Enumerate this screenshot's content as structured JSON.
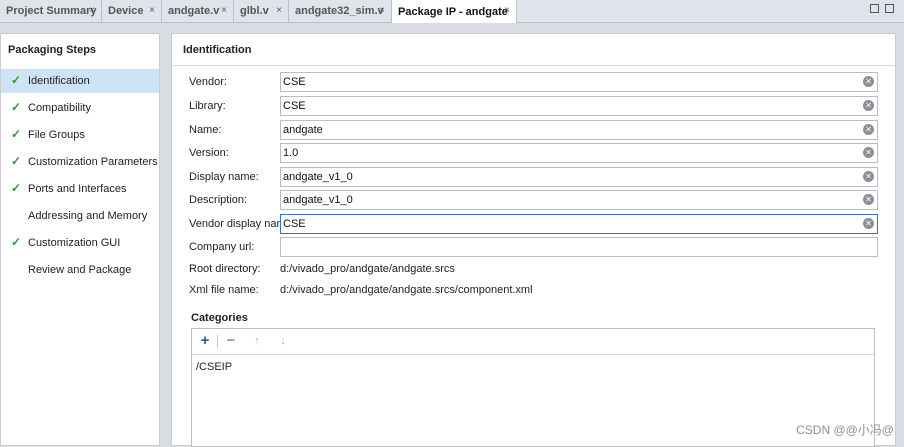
{
  "tabs": [
    {
      "label": "Project Summary",
      "close": "×"
    },
    {
      "label": "Device",
      "close": "×"
    },
    {
      "label": "andgate.v",
      "close": "×"
    },
    {
      "label": "glbl.v",
      "close": "×"
    },
    {
      "label": "andgate32_sim.v",
      "close": "×"
    },
    {
      "label": "Package IP - andgate",
      "close": "×"
    }
  ],
  "left_panel": {
    "title": "Packaging Steps",
    "check": "✓",
    "steps": [
      {
        "label": "Identification"
      },
      {
        "label": "Compatibility"
      },
      {
        "label": "File Groups"
      },
      {
        "label": "Customization Parameters"
      },
      {
        "label": "Ports and Interfaces"
      },
      {
        "label": "Addressing and Memory"
      },
      {
        "label": "Customization GUI"
      },
      {
        "label": "Review and Package"
      }
    ]
  },
  "identification": {
    "title": "Identification",
    "fields": [
      {
        "label": "Vendor:",
        "value": "CSE"
      },
      {
        "label": "Library:",
        "value": "CSE"
      },
      {
        "label": "Name:",
        "value": "andgate"
      },
      {
        "label": "Version:",
        "value": "1.0"
      },
      {
        "label": "Display name:",
        "value": "andgate_v1_0"
      },
      {
        "label": "Description:",
        "value": "andgate_v1_0"
      },
      {
        "label": "Vendor display name:",
        "value": "CSE"
      },
      {
        "label": "Company url:",
        "value": ""
      }
    ],
    "root_directory": {
      "label": "Root directory:",
      "value": "d:/vivado_pro/andgate/andgate.srcs"
    },
    "xml_file": {
      "label": "Xml file name:",
      "value": "d:/vivado_pro/andgate/andgate.srcs/component.xml"
    }
  },
  "categories": {
    "title": "Categories",
    "toolbar": {
      "add": "+",
      "remove": "−",
      "up": "↑",
      "down": "↓"
    },
    "items": [
      "/CSEIP"
    ]
  },
  "watermark": "CSDN @@小冯@"
}
